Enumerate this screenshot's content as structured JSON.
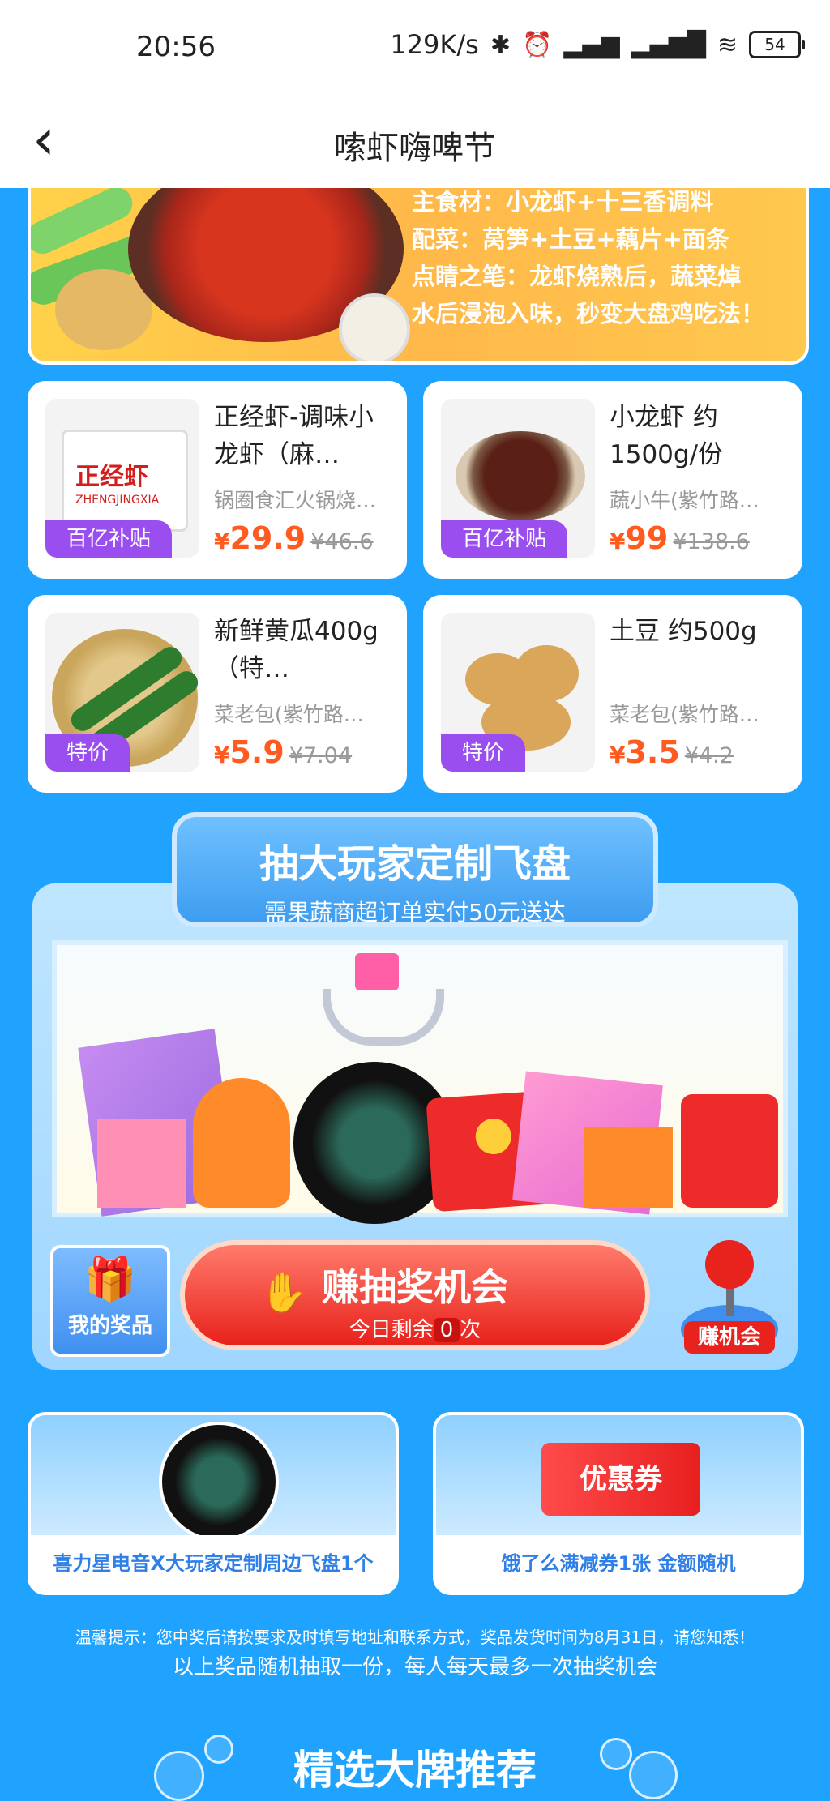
{
  "status_bar": {
    "time": "20:56",
    "net_speed": "129K/s",
    "battery": "54",
    "icons": [
      "bluetooth-icon",
      "alarm-icon",
      "hd-signal-icon",
      "signal-icon",
      "wifi-icon"
    ]
  },
  "nav": {
    "back_icon": "‹",
    "title": "嗦虾嗨啤节"
  },
  "banner": {
    "line1": "主食材：小龙虾+十三香调料",
    "line2_key": "配菜：",
    "line2": "莴笋+土豆+藕片+面条",
    "line3_key": "点睛之笔：",
    "line3": "龙虾烧熟后，蔬菜焯",
    "line4": "水后浸泡入味，秒变大盘鸡吃法！"
  },
  "products": [
    {
      "name": "正经虾-调味小龙虾（麻…",
      "shop": "锅圈食汇火锅烧…",
      "currency": "¥",
      "price": "29.9",
      "old_price": "¥46.6",
      "tag": "百亿补贴",
      "img_label": "正经虾",
      "img_sub": "ZHENGJINGXIA"
    },
    {
      "name": "小龙虾 约1500g/份",
      "shop": "蔬小牛(紫竹路…",
      "currency": "¥",
      "price": "99",
      "old_price": "¥138.6",
      "tag": "百亿补贴"
    },
    {
      "name": "新鲜黄瓜400g（特…",
      "shop": "菜老包(紫竹路…",
      "currency": "¥",
      "price": "5.9",
      "old_price": "¥7.04",
      "tag": "特价"
    },
    {
      "name": "土豆 约500g",
      "shop": "菜老包(紫竹路…",
      "currency": "¥",
      "price": "3.5",
      "old_price": "¥4.2",
      "tag": "特价"
    }
  ],
  "claw": {
    "title": "抽大玩家定制飞盘",
    "subtitle": "需果蔬商超订单实付50元送达",
    "my_prize": "我的奖品",
    "earn_title": "赚抽奖机会",
    "remain_prefix": "今日剩余",
    "remain_count": "0",
    "remain_suffix": "次",
    "earn_chance": "赚机会"
  },
  "prizes": [
    {
      "label": "喜力星电音X大玩家定制周边飞盘1个"
    },
    {
      "label": "饿了么满减券1张 金额随机",
      "coupon": "优惠券"
    }
  ],
  "tips": {
    "line1": "温馨提示：您中奖后请按要求及时填写地址和联系方式，奖品发货时间为8月31日，请您知悉！",
    "line2": "以上奖品随机抽取一份，每人每天最多一次抽奖机会"
  },
  "section": {
    "title": "精选大牌推荐"
  },
  "colors": {
    "page_bg": "#1fa3ff",
    "price": "#ff5a1f",
    "tag_bg": "#9a4ef0",
    "button_red": "#e8211c"
  }
}
